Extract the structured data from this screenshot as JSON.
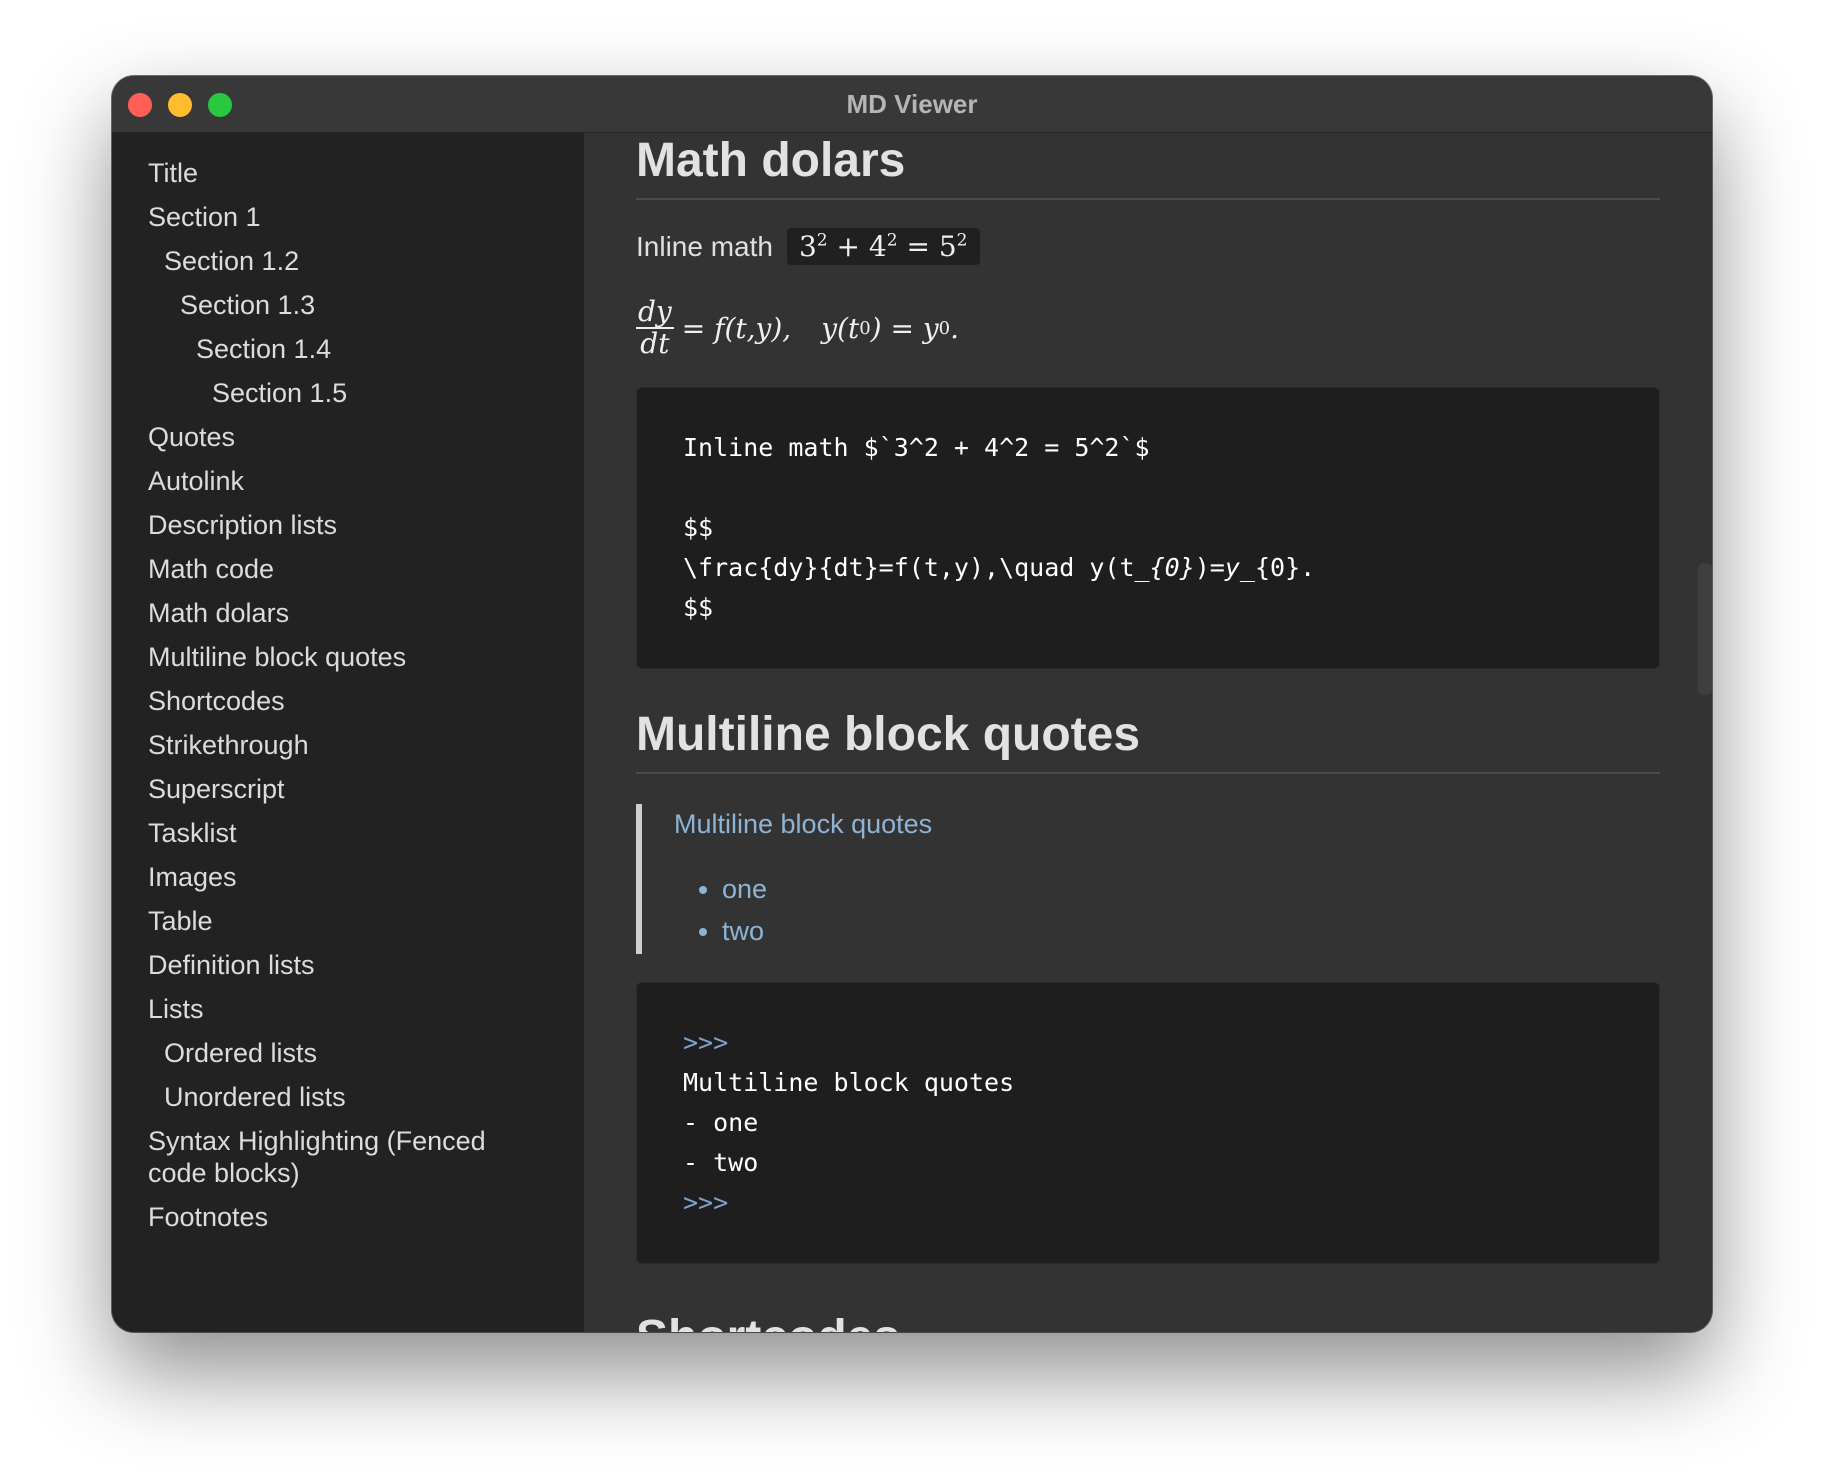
{
  "window": {
    "title": "MD Viewer"
  },
  "sidebar": {
    "items": [
      {
        "label": "Title",
        "level": 1
      },
      {
        "label": "Section 1",
        "level": 1
      },
      {
        "label": "Section 1.2",
        "level": 2
      },
      {
        "label": "Section 1.3",
        "level": 3
      },
      {
        "label": "Section 1.4",
        "level": 4
      },
      {
        "label": "Section 1.5",
        "level": 5
      },
      {
        "label": "Quotes",
        "level": 1
      },
      {
        "label": "Autolink",
        "level": 1
      },
      {
        "label": "Description lists",
        "level": 1
      },
      {
        "label": "Math code",
        "level": 1
      },
      {
        "label": "Math dolars",
        "level": 1
      },
      {
        "label": "Multiline block quotes",
        "level": 1
      },
      {
        "label": "Shortcodes",
        "level": 1
      },
      {
        "label": "Strikethrough",
        "level": 1
      },
      {
        "label": "Superscript",
        "level": 1
      },
      {
        "label": "Tasklist",
        "level": 1
      },
      {
        "label": "Images",
        "level": 1
      },
      {
        "label": "Table",
        "level": 1
      },
      {
        "label": "Definition lists",
        "level": 1
      },
      {
        "label": "Lists",
        "level": 1
      },
      {
        "label": "Ordered lists",
        "level": 2
      },
      {
        "label": "Unordered lists",
        "level": 2
      },
      {
        "label": "Syntax Highlighting (Fenced code blocks)",
        "level": 1
      },
      {
        "label": "Footnotes",
        "level": 1
      }
    ]
  },
  "content": {
    "math_section": {
      "heading": "Math dolars",
      "inline_label": "Inline math",
      "inline_math": {
        "b1": "3",
        "e1": "2",
        "op1": "+",
        "b2": "4",
        "e2": "2",
        "eq": "=",
        "b3": "5",
        "e3": "2"
      },
      "display_math": {
        "num": "dy",
        "den": "dt",
        "rhs1": "= f(t,y),",
        "rhs2_pre": "y(t",
        "rhs2_sub": "0",
        "rhs2_mid": ") = y",
        "rhs2_sub2": "0",
        "rhs2_end": "."
      },
      "code_lines": {
        "l1": "Inline math $`3^2 + 4^2 = 5^2`$",
        "l2": "$$",
        "l3_a": "\\frac{dy}{dt}=f(t,y),\\quad y(t_",
        "l3_b": "{0}",
        "l3_c": ")=",
        "l3_d": "y_",
        "l3_e": "{0}.",
        "l4": "$$"
      }
    },
    "quotes_section": {
      "heading": "Multiline block quotes",
      "quote_title": "Multiline block quotes",
      "quote_items": [
        "one",
        "two"
      ],
      "code_lines": {
        "open": ">>>",
        "l1": "Multiline block quotes",
        "l2": "- one",
        "l3": "- two",
        "close": ">>>"
      }
    },
    "next_heading": "Shortcodes"
  }
}
